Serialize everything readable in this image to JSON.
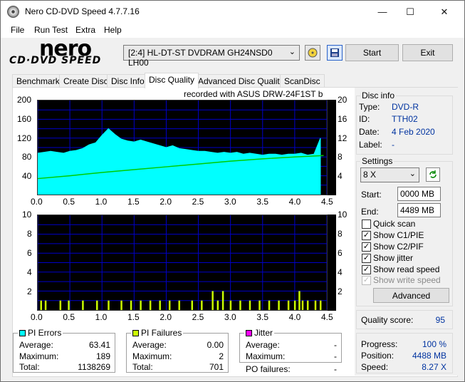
{
  "window": {
    "title": "Nero CD-DVD Speed 4.7.7.16"
  },
  "menu": [
    "File",
    "Run Test",
    "Extra",
    "Help"
  ],
  "toolbar": {
    "logo_top": "nero",
    "logo_bottom": "CD·DVD SPEED",
    "drive": "[2:4]  HL-DT-ST DVDRAM GH24NSD0 LH00",
    "start_label": "Start",
    "exit_label": "Exit"
  },
  "tabs": [
    "Benchmark",
    "Create Disc",
    "Disc Info",
    "Disc Quality",
    "Advanced Disc Quality",
    "ScanDisc"
  ],
  "active_tab": "Disc Quality",
  "recorded_with": "recorded with ASUS    DRW-24F1ST   b",
  "disc_info": {
    "title": "Disc info",
    "type_label": "Type:",
    "type": "DVD-R",
    "id_label": "ID:",
    "id": "TTH02",
    "date_label": "Date:",
    "date": "4 Feb 2020",
    "label_label": "Label:",
    "label": "-"
  },
  "settings": {
    "title": "Settings",
    "speed": "8 X",
    "start_label": "Start:",
    "start": "0000 MB",
    "end_label": "End:",
    "end": "4489 MB",
    "quick_scan": "Quick scan",
    "show_c1": "Show C1/PIE",
    "show_c2": "Show C2/PIF",
    "show_jitter": "Show jitter",
    "show_read": "Show read speed",
    "show_write": "Show write speed",
    "advanced_label": "Advanced"
  },
  "quality": {
    "label": "Quality score:",
    "value": "95"
  },
  "progress": {
    "progress_label": "Progress:",
    "progress": "100 %",
    "position_label": "Position:",
    "position": "4488 MB",
    "speed_label": "Speed:",
    "speed": "8.27 X"
  },
  "pi_errors": {
    "title": "PI Errors",
    "avg_label": "Average:",
    "avg": "63.41",
    "max_label": "Maximum:",
    "max": "189",
    "total_label": "Total:",
    "total": "1138269"
  },
  "pi_failures": {
    "title": "PI Failures",
    "avg_label": "Average:",
    "avg": "0.00",
    "max_label": "Maximum:",
    "max": "2",
    "total_label": "Total:",
    "total": "701"
  },
  "jitter": {
    "title": "Jitter",
    "avg_label": "Average:",
    "avg": "-",
    "max_label": "Maximum:",
    "max": "-",
    "po_label": "PO failures:",
    "po": "-"
  },
  "colors": {
    "pie": "#00ffff",
    "pif": "#ccff00",
    "jitter": "#ff00ff",
    "speed": "#00cc00",
    "grid": "#0000c8"
  },
  "chart_data": [
    {
      "type": "area",
      "x_ticks": [
        "0.0",
        "0.5",
        "1.0",
        "1.5",
        "2.0",
        "2.5",
        "3.0",
        "3.5",
        "4.0",
        "4.5"
      ],
      "y_left_ticks": [
        "200",
        "160",
        "120",
        "80",
        "40"
      ],
      "y_right_ticks": [
        "20",
        "16",
        "12",
        "8",
        "4"
      ],
      "xlim": [
        0,
        4.5
      ],
      "ylim": [
        0,
        200
      ],
      "y2lim": [
        0,
        20
      ],
      "series": [
        {
          "x": [
            0.0,
            0.1,
            0.2,
            0.3,
            0.4,
            0.5,
            0.6,
            0.7,
            0.8,
            0.9,
            1.0,
            1.1,
            1.2,
            1.3,
            1.4,
            1.5,
            1.6,
            1.7,
            1.8,
            1.9,
            2.0,
            2.1,
            2.2,
            2.3,
            2.4,
            2.5,
            2.6,
            2.7,
            2.8,
            2.9,
            3.0,
            3.1,
            3.2,
            3.3,
            3.4,
            3.5,
            3.6,
            3.7,
            3.8,
            3.9,
            4.0,
            4.1,
            4.2,
            4.3,
            4.4
          ],
          "values": [
            88,
            90,
            92,
            90,
            88,
            92,
            94,
            98,
            106,
            110,
            126,
            140,
            128,
            118,
            114,
            112,
            116,
            112,
            108,
            104,
            100,
            104,
            98,
            96,
            94,
            92,
            92,
            90,
            88,
            90,
            88,
            90,
            86,
            88,
            86,
            84,
            86,
            86,
            84,
            86,
            86,
            88,
            84,
            86,
            120
          ]
        },
        {
          "x": [
            0.0,
            0.5,
            1.0,
            1.5,
            2.0,
            2.5,
            3.0,
            3.5,
            4.0,
            4.45
          ],
          "values": [
            3.4,
            4.0,
            4.7,
            5.3,
            5.9,
            6.5,
            7.1,
            7.6,
            8.0,
            8.3
          ]
        }
      ]
    },
    {
      "type": "bar",
      "x_ticks": [
        "0.0",
        "0.5",
        "1.0",
        "1.5",
        "2.0",
        "2.5",
        "3.0",
        "3.5",
        "4.0",
        "4.5"
      ],
      "y_left_ticks": [
        "10",
        "8",
        "6",
        "4",
        "2"
      ],
      "y_right_ticks": [
        "10",
        "8",
        "6",
        "4",
        "2"
      ],
      "xlim": [
        0,
        4.5
      ],
      "ylim": [
        0,
        10
      ],
      "series": [
        {
          "x": [
            0.05,
            0.12,
            0.35,
            0.48,
            0.7,
            0.92,
            1.1,
            1.3,
            1.45,
            1.6,
            1.75,
            1.9,
            2.05,
            2.2,
            2.4,
            2.55,
            2.72,
            2.8,
            2.88,
            3.0,
            3.15,
            3.3,
            3.45,
            3.6,
            3.75,
            3.9,
            4.0,
            4.07,
            4.12,
            4.2,
            4.32,
            4.4
          ],
          "values": [
            1,
            1,
            1,
            1,
            1,
            1,
            1,
            1,
            1,
            1,
            1,
            1,
            1,
            1,
            1,
            1,
            2,
            1,
            2,
            1,
            1,
            1,
            1,
            1,
            1,
            1,
            1,
            2,
            1,
            1,
            1,
            1
          ]
        }
      ]
    }
  ]
}
